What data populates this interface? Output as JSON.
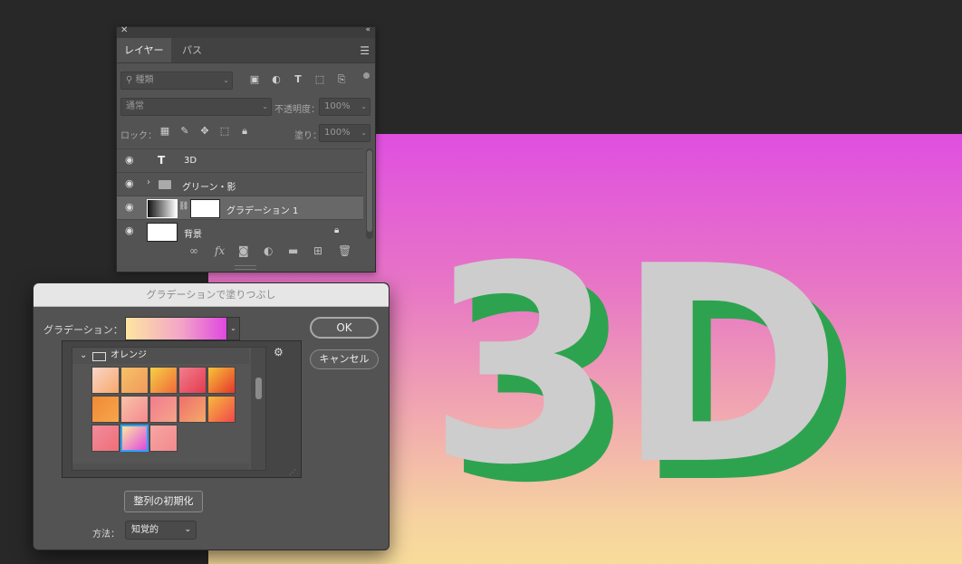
{
  "layers_panel": {
    "tabs": [
      "レイヤー",
      "パス"
    ],
    "filter_placeholder": "種類",
    "blend_mode": "通常",
    "opacity_label": "不透明度：",
    "opacity_value": "100%",
    "lock_label": "ロック：",
    "fill_label": "塗り：",
    "fill_value": "100%",
    "layers": [
      {
        "name": "3D",
        "type": "text"
      },
      {
        "name": "グリーン・影",
        "type": "group"
      },
      {
        "name": "グラデーション 1",
        "type": "gradient-fill",
        "selected": true
      },
      {
        "name": "背景",
        "type": "background",
        "locked": true
      }
    ],
    "footer_icons": [
      "link-icon",
      "fx-icon",
      "mask-icon",
      "adjustment-icon",
      "folder-icon",
      "new-layer-icon",
      "trash-icon"
    ]
  },
  "canvas": {
    "text": "3D",
    "text_color": "#cdcdcd",
    "shadow_color": "#2ea34f"
  },
  "dialog": {
    "title": "グラデーションで塗りつぶし",
    "gradient_label": "グラデーション：",
    "ok_label": "OK",
    "cancel_label": "キャンセル",
    "folder_name": "オレンジ",
    "reset_alignment_label": "整列の初期化",
    "method_label": "方法：",
    "method_value": "知覚的",
    "swatches": [
      [
        "#f9d6c8",
        "#f7a86b"
      ],
      [
        "#f6c16a",
        "#f09a58"
      ],
      [
        "#f5d046",
        "#f06a39"
      ],
      [
        "#f07e8d",
        "#e53a4f"
      ],
      [
        "#f6c43a",
        "#e8362b"
      ],
      [
        "#f08a34",
        "#f6a64e"
      ],
      [
        "#f8c2a8",
        "#f48a8e"
      ],
      [
        "#f27c8e",
        "#f5a488"
      ],
      [
        "#ef6f6c",
        "#f5a96a"
      ],
      [
        "#f7b93e",
        "#f0484a"
      ],
      [
        "#f28b9a",
        "#ef6f7a"
      ],
      [
        "#fde6a0",
        "#df48e0"
      ],
      [
        "#f7a6a4",
        "#f28a8a"
      ]
    ]
  }
}
